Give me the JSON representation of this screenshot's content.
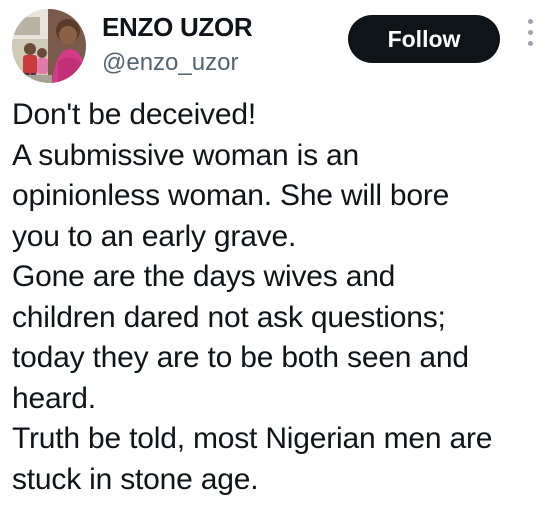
{
  "author": {
    "display_name": "ENZO UZOR",
    "handle": "@enzo_uzor",
    "avatar_icon": "profile-photo"
  },
  "actions": {
    "follow_label": "Follow",
    "more_icon": "more-vertical-icon"
  },
  "tweet": {
    "lines": [
      "Don't be deceived!",
      "A submissive woman is an",
      "opinionless woman. She will bore",
      "you to an early grave.",
      "Gone are the days wives and",
      "children dared not ask questions;",
      "today they are to be both seen and",
      "heard.",
      "Truth be told, most Nigerian men are",
      "stuck in stone age."
    ]
  },
  "colors": {
    "text": "#0f1419",
    "secondary": "#536471",
    "button_bg": "#0f1419",
    "button_text": "#ffffff",
    "background": "#ffffff"
  }
}
